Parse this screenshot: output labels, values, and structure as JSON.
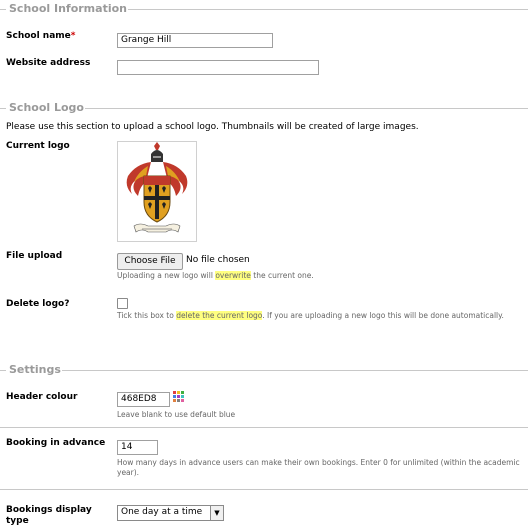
{
  "school_info": {
    "legend": "School Information",
    "name_label": "School name",
    "name_required": "*",
    "name_value": "Grange Hill",
    "website_label": "Website address",
    "website_value": ""
  },
  "school_logo": {
    "legend": "School Logo",
    "intro": "Please use this section to upload a school logo. Thumbnails will be created of large images.",
    "current_logo_label": "Current logo",
    "file_upload_label": "File upload",
    "choose_file_button": "Choose File",
    "no_file_text": "No file chosen",
    "upload_help_pre": "Uploading a new logo will ",
    "upload_help_hl": "overwrite",
    "upload_help_post": " the current one.",
    "delete_label": "Delete logo?",
    "delete_checked": false,
    "delete_help_pre": "Tick this box to ",
    "delete_help_hl": "delete the current logo",
    "delete_help_post": ". If you are uploading a new logo this will be done automatically."
  },
  "settings": {
    "legend": "Settings",
    "header_colour_label": "Header colour",
    "header_colour_value": "468ED8",
    "header_colour_help": "Leave blank to use default blue",
    "booking_advance_label": "Booking in advance",
    "booking_advance_value": "14",
    "booking_advance_help": "How many days in advance users can make their own bookings. Enter 0 for unlimited (within the academic year).",
    "display_type_label": "Bookings display type",
    "display_type_value": "One day at a time"
  },
  "colors": {
    "legend_text": "#9a9a9a",
    "required": "#cc0000",
    "highlight": "#ffff80",
    "crest_red": "#c0392b",
    "crest_gold": "#e0a020"
  }
}
